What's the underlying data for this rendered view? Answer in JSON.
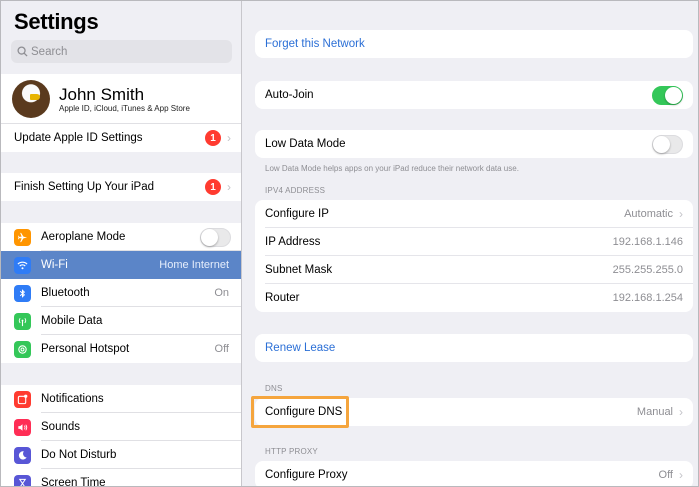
{
  "sidebar": {
    "title": "Settings",
    "search_placeholder": "Search",
    "profile": {
      "name": "John Smith",
      "subtitle": "Apple ID, iCloud, iTunes & App Store"
    },
    "update_apple_id": {
      "label": "Update Apple ID Settings",
      "badge": "1"
    },
    "finish_setup": {
      "label": "Finish Setting Up Your iPad",
      "badge": "1"
    },
    "connectivity": [
      {
        "label": "Aeroplane Mode",
        "value": "",
        "icon": "airplane-icon",
        "color": "#ff9500"
      },
      {
        "label": "Wi-Fi",
        "value": "Home Internet",
        "icon": "wifi-icon",
        "color": "#2f7cf6"
      },
      {
        "label": "Bluetooth",
        "value": "On",
        "icon": "bluetooth-icon",
        "color": "#2f7cf6"
      },
      {
        "label": "Mobile Data",
        "value": "",
        "icon": "antenna-icon",
        "color": "#34c759"
      },
      {
        "label": "Personal Hotspot",
        "value": "Off",
        "icon": "hotspot-icon",
        "color": "#34c759"
      }
    ],
    "notifications": [
      {
        "label": "Notifications",
        "icon": "notifications-icon",
        "color": "#ff3b30"
      },
      {
        "label": "Sounds",
        "icon": "speaker-icon",
        "color": "#ff2d55"
      },
      {
        "label": "Do Not Disturb",
        "icon": "moon-icon",
        "color": "#5856d6"
      },
      {
        "label": "Screen Time",
        "icon": "hourglass-icon",
        "color": "#5856d6"
      }
    ]
  },
  "detail": {
    "forget_network": "Forget this Network",
    "auto_join": {
      "label": "Auto-Join",
      "on": true
    },
    "low_data": {
      "label": "Low Data Mode",
      "on": false,
      "note": "Low Data Mode helps apps on your iPad reduce their network data use."
    },
    "ipv4_header": "IPV4 ADDRESS",
    "ipv4": [
      {
        "label": "Configure IP",
        "value": "Automatic",
        "chevron": true
      },
      {
        "label": "IP Address",
        "value": "192.168.1.146",
        "chevron": false
      },
      {
        "label": "Subnet Mask",
        "value": "255.255.255.0",
        "chevron": false
      },
      {
        "label": "Router",
        "value": "192.168.1.254",
        "chevron": false
      }
    ],
    "renew_lease": "Renew Lease",
    "dns_header": "DNS",
    "configure_dns": {
      "label": "Configure DNS",
      "value": "Manual"
    },
    "http_header": "HTTP PROXY",
    "configure_proxy": {
      "label": "Configure Proxy",
      "value": "Off"
    }
  },
  "colors": {
    "accent": "#2b6fd6",
    "selection": "#5b85c8",
    "toggle_on": "#34c759",
    "badge": "#ff3b30",
    "highlight": "#f5a53d"
  }
}
